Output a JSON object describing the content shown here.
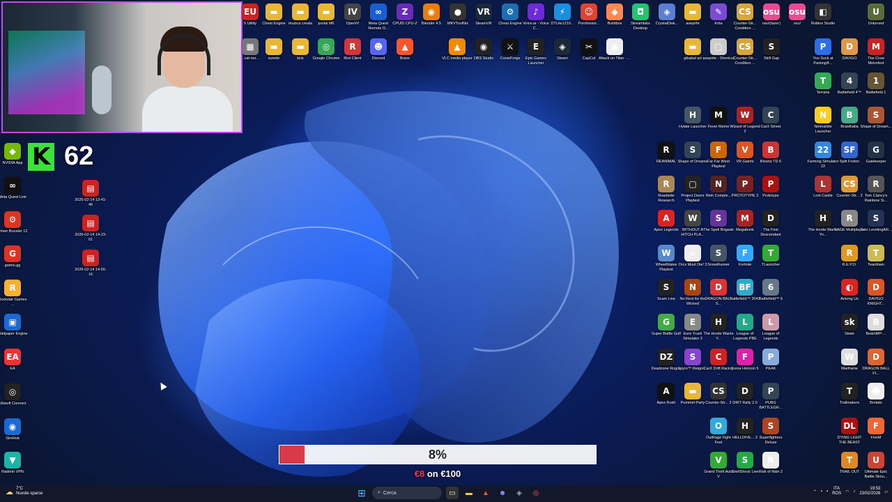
{
  "webcam": {
    "label": "Streamer webcam overlay"
  },
  "counter": {
    "logo": "K",
    "value": "62"
  },
  "donation": {
    "percent": "8%",
    "progress": 0.08,
    "raised": "€8",
    "goal_text": "on €100"
  },
  "taskbar": {
    "weather_temp": "7°C",
    "weather_desc": "Nuvole sparse",
    "search_placeholder": "Cerca",
    "lang": "ITA",
    "kb": "ROS",
    "time": "19:53",
    "date": "23/02/2026"
  },
  "icons": {
    "top": [
      {
        "l": "5 Utility",
        "c": "#c22",
        "g": "EU"
      },
      {
        "l": "Cheat Engine",
        "c": "#e7b735",
        "g": "▬"
      },
      {
        "l": "muzica creata",
        "c": "#e7b735",
        "g": "▬"
      },
      {
        "l": "portal bf6",
        "c": "#e7b735",
        "g": "▬"
      },
      {
        "l": "OpenIV",
        "c": "#444",
        "g": "IV"
      },
      {
        "l": "Meta Quest Remote D...",
        "c": "#1a5fd0",
        "g": "∞"
      },
      {
        "l": "CPUID CPU-Z",
        "c": "#6a2bb8",
        "g": "Z"
      },
      {
        "l": "Blender 4.5",
        "c": "#e87d0d",
        "g": "◉"
      },
      {
        "l": "MKVToolNix",
        "c": "#333",
        "g": "●"
      },
      {
        "l": "SteamVR",
        "c": "#1b2838",
        "g": "VR"
      },
      {
        "l": "Cheat Engine",
        "c": "#1b6fb0",
        "g": "⚙"
      },
      {
        "l": "Voice.ai - Voice C...",
        "c": "#6c2bd6",
        "g": "♪"
      },
      {
        "l": "DTLite1210...",
        "c": "#1a8fe0",
        "g": "⚡"
      },
      {
        "l": "Porofessor...",
        "c": "#d43",
        "g": "☺"
      },
      {
        "l": "Buildbox",
        "c": "#f85",
        "g": "◆"
      },
      {
        "l": "Streamlabs Desktop",
        "c": "#21c46f",
        "g": "◘"
      },
      {
        "l": "CrystalDisk...",
        "c": "#5a7fd0",
        "g": "◈"
      },
      {
        "l": "aseprite",
        "c": "#e7b735",
        "g": "▬"
      },
      {
        "l": "Krita",
        "c": "#7c4bd6",
        "g": "✎"
      },
      {
        "l": "Counter-Str... Condition ...",
        "c": "#d8a53b",
        "g": "CS"
      },
      {
        "l": "osu!(lazer)",
        "c": "#e94b91",
        "g": "osu"
      },
      {
        "l": "osu!",
        "c": "#e94b91",
        "g": "osu"
      },
      {
        "l": "Roblox Studio",
        "c": "#333",
        "g": "◧"
      },
      {
        "l": "Unturned",
        "c": "#5a6b3a",
        "g": "U"
      }
    ],
    "second": [
      {
        "l": "...cat-me...",
        "c": "#777",
        "g": "▦"
      },
      {
        "l": "sunete",
        "c": "#e7b735",
        "g": "▬"
      },
      {
        "l": "kick",
        "c": "#e7b735",
        "g": "▬"
      },
      {
        "l": "Google Chrome",
        "c": "#34a853",
        "g": "◎"
      },
      {
        "l": "Riot Client",
        "c": "#d13639",
        "g": "R"
      },
      {
        "l": "Discord",
        "c": "#5865f2",
        "g": "☻"
      },
      {
        "l": "Brave",
        "c": "#fb542b",
        "g": "▲"
      },
      {
        "l": "VLC media player",
        "c": "#f08c00",
        "g": "▲"
      },
      {
        "l": "OBS Studio",
        "c": "#222",
        "g": "◉"
      },
      {
        "l": "CurseForge",
        "c": "#111",
        "g": "⚔"
      },
      {
        "l": "Epic Games Launcher",
        "c": "#222",
        "g": "E"
      },
      {
        "l": "Steam",
        "c": "#1b2838",
        "g": "◈"
      },
      {
        "l": "CapCut",
        "c": "#111",
        "g": "✂"
      },
      {
        "l": "Attack on Titan - ...",
        "c": "#eee",
        "g": "▣"
      },
      {
        "l": "gibabal art",
        "c": "#e7b735",
        "g": "▬"
      },
      {
        "l": "aseprite - Shortcut",
        "c": "#ccc",
        "g": "▢"
      },
      {
        "l": "Counter-Str... Condition ...",
        "c": "#d8a53b",
        "g": "CS"
      },
      {
        "l": "Skill Gap",
        "c": "#222",
        "g": "S"
      },
      {
        "l": "You Suck at Parking®...",
        "c": "#2c6ee8",
        "g": "P"
      },
      {
        "l": "DAVIGO",
        "c": "#d94",
        "g": "D"
      },
      {
        "l": "The Crew Motorfest",
        "c": "#c22",
        "g": "M"
      }
    ],
    "left": [
      {
        "l": "NVIDIA App",
        "c": "#76b900",
        "g": "◆"
      },
      {
        "l": "Meta Quest Link",
        "c": "#111",
        "g": "∞"
      },
      {
        "l": "Driver Booster 12",
        "c": "#d32",
        "g": "⚙"
      },
      {
        "l": "gamio.gg",
        "c": "#d32",
        "g": "G"
      },
      {
        "l": "Rockstar Games ...",
        "c": "#fbb034",
        "g": "R"
      },
      {
        "l": "Wallpaper Engine",
        "c": "#1a6ad6",
        "g": "▣"
      },
      {
        "l": "EA",
        "c": "#e33",
        "g": "EA"
      },
      {
        "l": "Ubisoft Connect",
        "c": "#222",
        "g": "◎"
      },
      {
        "l": "SimHub",
        "c": "#1a6ad6",
        "g": "◉"
      },
      {
        "l": "Radmin VPN",
        "c": "#1cb4a6",
        "g": "▼"
      }
    ],
    "recordings": [
      {
        "l": "2026-02-14 13-41-46",
        "c": "#c22",
        "g": "▤"
      },
      {
        "l": "2026-02-14 14-23-01",
        "c": "#c22",
        "g": "▤"
      },
      {
        "l": "2026-02-14 14-55-16",
        "c": "#c22",
        "g": "▤"
      }
    ],
    "grid_right": [
      [
        {
          "l": "Hytale Launcher",
          "c": "#456",
          "g": "H"
        },
        {
          "l": "Fever Meme",
          "c": "#111",
          "g": "M"
        },
        {
          "l": "Wizard of Legend 2",
          "c": "#a22",
          "g": "W"
        },
        {
          "l": "CarX Street",
          "c": "#345",
          "g": "C"
        }
      ],
      [
        {
          "l": "REANIMAL",
          "c": "#111",
          "g": "R"
        },
        {
          "l": "Shape of Dreams",
          "c": "#345",
          "g": "S"
        },
        {
          "l": "Far Far West Playtest",
          "c": "#c60",
          "g": "F"
        },
        {
          "l": "VR Giants",
          "c": "#d52",
          "g": "V"
        },
        {
          "l": "Bloons TD 6",
          "c": "#c33",
          "g": "B"
        }
      ],
      [
        {
          "l": "Roadside Research",
          "c": "#a85",
          "g": "R"
        },
        {
          "l": "Project Doors Playtest",
          "c": "#222",
          "g": "▢"
        },
        {
          "l": "Nioh Comple...",
          "c": "#522",
          "g": "N"
        },
        {
          "l": "PROTOTYPE 2",
          "c": "#722",
          "g": "P"
        },
        {
          "l": "Prototype",
          "c": "#a11",
          "g": "P"
        }
      ],
      [
        {
          "l": "Apex Legends",
          "c": "#d22",
          "g": "A"
        },
        {
          "l": "WITHOUT A HITCH PLA...",
          "c": "#444",
          "g": "W"
        },
        {
          "l": "The Spell Brigade",
          "c": "#639",
          "g": "S"
        },
        {
          "l": "Megabonk",
          "c": "#a22",
          "g": "M"
        },
        {
          "l": "The First Descendant",
          "c": "#222",
          "g": "D"
        }
      ],
      [
        {
          "l": "WheelMates Playtest",
          "c": "#58c",
          "g": "W"
        },
        {
          "l": "Orcs Must Die! 3",
          "c": "#eee",
          "g": "☠"
        },
        {
          "l": "SnowRunner",
          "c": "#456",
          "g": "S"
        },
        {
          "l": "Fortnite",
          "c": "#3af",
          "g": "F"
        },
        {
          "l": "TLauncher",
          "c": "#3a3",
          "g": "T"
        }
      ],
      [
        {
          "l": "Scam Line",
          "c": "#222",
          "g": "S"
        },
        {
          "l": "No Rest for the Wicked",
          "c": "#a41",
          "g": "N"
        },
        {
          "l": "DRAGON BALL S...",
          "c": "#d33",
          "g": "D"
        },
        {
          "l": "Battlefield™ 2042",
          "c": "#3ac",
          "g": "BF"
        },
        {
          "l": "Battlefield™ 6",
          "c": "#678",
          "g": "6"
        }
      ],
      [
        {
          "l": "Super Battle Golf",
          "c": "#4a4",
          "g": "G"
        },
        {
          "l": "Euro Truck Simulator 2",
          "c": "#888",
          "g": "E"
        },
        {
          "l": "The Horde Wants Y...",
          "c": "#222",
          "g": "H"
        },
        {
          "l": "League of Legends PBE",
          "c": "#2a8",
          "g": "L"
        },
        {
          "l": "League of Legends",
          "c": "#c9a",
          "g": "L"
        }
      ],
      [
        {
          "l": "Deadzone Rogue",
          "c": "#222",
          "g": "DZ"
        },
        {
          "l": "Spyro™ Reignit...",
          "c": "#84c",
          "g": "S"
        },
        {
          "l": "CarX Drift Racing ...",
          "c": "#c22",
          "g": "C"
        },
        {
          "l": "Forza Horizon 5",
          "c": "#d2a",
          "g": "F"
        },
        {
          "l": "PEAK",
          "c": "#8ad",
          "g": "P"
        }
      ],
      [
        {
          "l": "Apex Rush",
          "c": "#111",
          "g": "A"
        },
        {
          "l": "Pummel Party",
          "c": "#e7b735",
          "g": "▬"
        },
        {
          "l": "Counter-Str... 2",
          "c": "#333",
          "g": "CS"
        },
        {
          "l": "DIRT Rally 2.0",
          "c": "#222",
          "g": "D"
        },
        {
          "l": "PUBG BATTLEGR...",
          "c": "#345",
          "g": "P"
        }
      ],
      [
        {
          "l": "OutRage Fight Fest",
          "c": "#3ad",
          "g": "O"
        },
        {
          "l": "HELLDIVE... 2",
          "c": "#222",
          "g": "H"
        },
        {
          "l": "Superfighters Deluxe",
          "c": "#a42",
          "g": "S"
        }
      ],
      [
        {
          "l": "Grand Theft Auto V",
          "c": "#3a3",
          "g": "V"
        },
        {
          "l": "ShellShock Live",
          "c": "#2a4",
          "g": "S"
        },
        {
          "l": "Risk of Rain 2",
          "c": "#eee",
          "g": "R"
        }
      ]
    ],
    "far_right": [
      [
        {
          "l": "Terraria",
          "c": "#3a5",
          "g": "T"
        },
        {
          "l": "Battlefield 4™",
          "c": "#345",
          "g": "4"
        },
        {
          "l": "Battlefield 1",
          "c": "#653",
          "g": "1"
        }
      ],
      [
        {
          "l": "Netmarble Launcher",
          "c": "#fc2",
          "g": "N"
        },
        {
          "l": "Brawlhalla",
          "c": "#4a8",
          "g": "B"
        },
        {
          "l": "Shape of Dream...",
          "c": "#a53",
          "g": "S"
        }
      ],
      [
        {
          "l": "Farming Simulator 22",
          "c": "#38d",
          "g": "22"
        },
        {
          "l": "Split Fiction",
          "c": "#36c",
          "g": "SF"
        },
        {
          "l": "Gatekeeper",
          "c": "#234",
          "g": "G"
        }
      ],
      [
        {
          "l": "Lost Castle",
          "c": "#a33",
          "g": "L"
        },
        {
          "l": "Counter-Str... 2",
          "c": "#d93",
          "g": "CS"
        },
        {
          "l": "Tom Clancy's Rainbow Si...",
          "c": "#555",
          "g": "R"
        }
      ],
      [
        {
          "l": "The Horde Wants Yo...",
          "c": "#222",
          "g": "H"
        },
        {
          "l": "RAGE Multiplayer",
          "c": "#888",
          "g": "R"
        },
        {
          "l": "Solo LevelingAR...",
          "c": "#235",
          "g": "S"
        }
      ],
      [
        {
          "l": "R.E.P.O.",
          "c": "#d92",
          "g": "R"
        },
        {
          "l": "Teardown",
          "c": "#cb5",
          "g": "T"
        }
      ],
      [
        {
          "l": "Among Us",
          "c": "#d22",
          "g": "◐"
        },
        {
          "l": "DAVIGO KNIGHT...",
          "c": "#d52",
          "g": "D"
        }
      ],
      [
        {
          "l": "Skate",
          "c": "#222",
          "g": "sk"
        },
        {
          "l": "BeamMP-...",
          "c": "#ddd",
          "g": "B"
        }
      ],
      [
        {
          "l": "Warframe",
          "c": "#ddd",
          "g": "W"
        },
        {
          "l": "DRAGON BALL FI...",
          "c": "#d63",
          "g": "D"
        }
      ],
      [
        {
          "l": "Trailmakers",
          "c": "#222",
          "g": "T"
        },
        {
          "l": "Brotato",
          "c": "#eee",
          "g": "☻"
        }
      ],
      [
        {
          "l": "DYING LIGHT THE BEAST",
          "c": "#a11",
          "g": "DL"
        },
        {
          "l": "FiveM",
          "c": "#e63",
          "g": "F"
        }
      ],
      [
        {
          "l": "TRAIL OUT",
          "c": "#d82",
          "g": "T"
        },
        {
          "l": "Ultimate Epic Battle Simu...",
          "c": "#c43",
          "g": "U"
        }
      ]
    ]
  }
}
